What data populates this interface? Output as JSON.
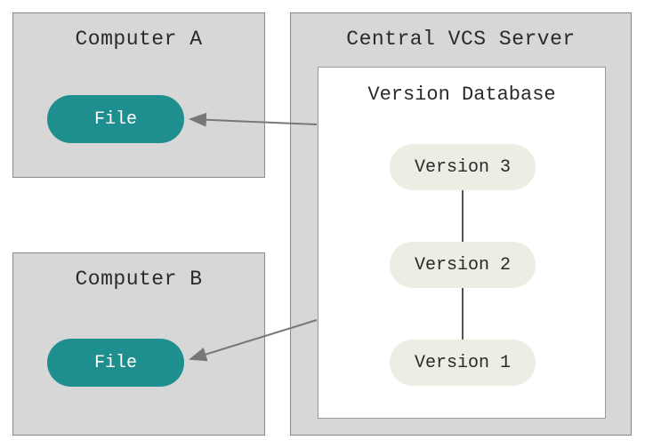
{
  "computerA": {
    "title": "Computer A",
    "file_label": "File"
  },
  "computerB": {
    "title": "Computer B",
    "file_label": "File"
  },
  "server": {
    "title": "Central VCS Server",
    "database": {
      "title": "Version Database",
      "versions": [
        {
          "label": "Version 3"
        },
        {
          "label": "Version 2"
        },
        {
          "label": "Version 1"
        }
      ]
    }
  },
  "arrows": [
    {
      "from": "server-database",
      "to": "computerA-file"
    },
    {
      "from": "server-database",
      "to": "computerB-file"
    }
  ],
  "colors": {
    "box_bg": "#d7d7d7",
    "file_pill": "#1e8e8e",
    "version_pill": "#edede3",
    "arrow": "#777"
  }
}
